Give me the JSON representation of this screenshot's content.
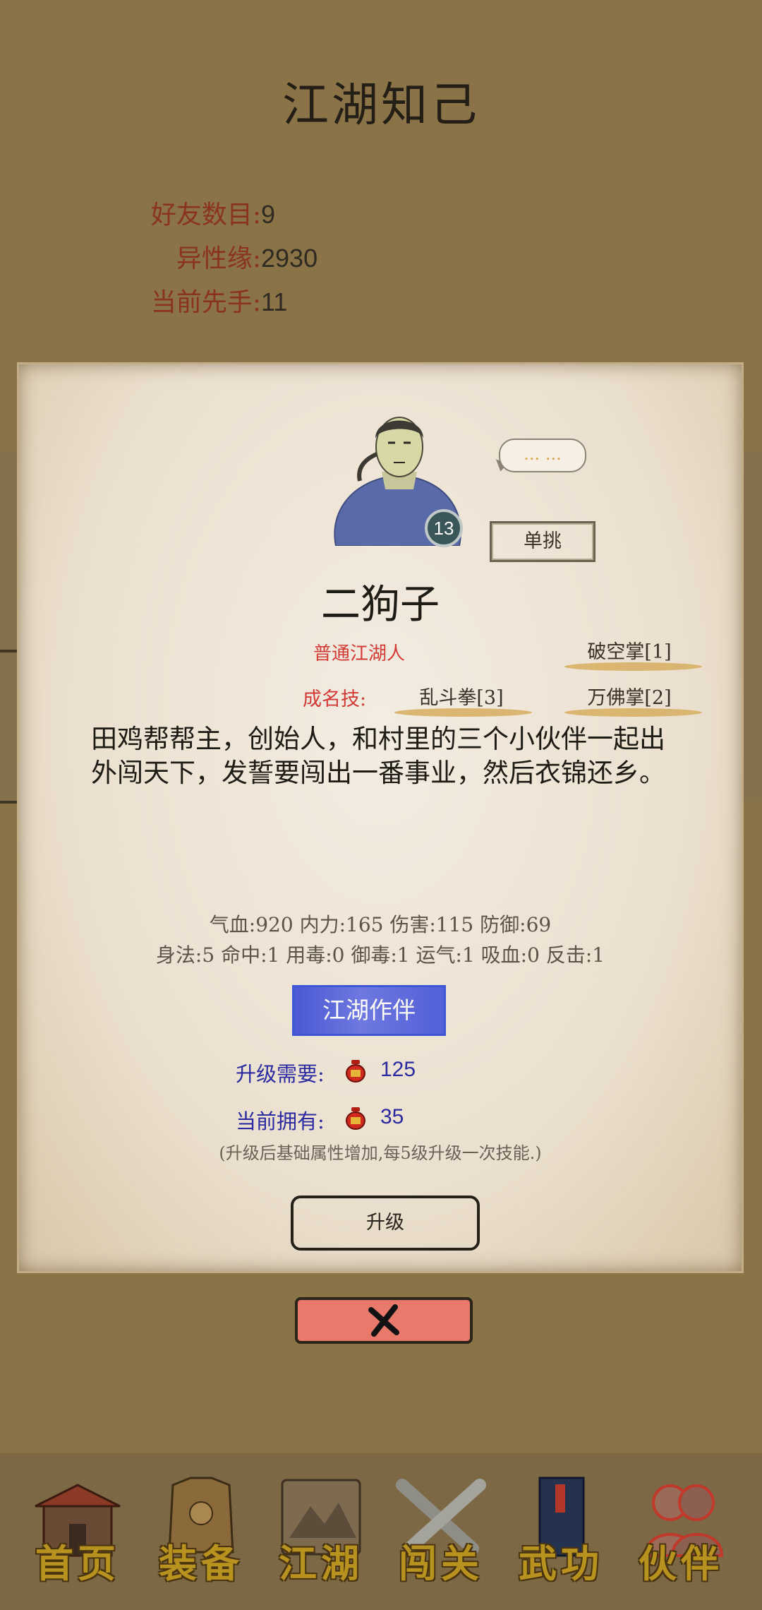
{
  "page": {
    "title": "江湖知己",
    "stats": [
      {
        "label": "好友数目:",
        "value": "9"
      },
      {
        "label": "异性缘:",
        "value": "2930"
      },
      {
        "label": "当前先手:",
        "value": "11"
      }
    ]
  },
  "dialog": {
    "level": "13",
    "speech": "... ...",
    "duel_label": "单挑",
    "name": "二狗子",
    "rank": "普通江湖人",
    "signature_label": "成名技:",
    "skills": [
      "破空掌[1]",
      "乱斗拳[3]",
      "万佛掌[2]"
    ],
    "description": "田鸡帮帮主，创始人，和村里的三个小伙伴一起出外闯天下，发誓要闯出一番事业，然后衣锦还乡。",
    "attributes_line1": "气血:920  内力:165  伤害:115  防御:69",
    "attributes_line2": "身法:5  命中:1  用毒:0  御毒:1  运气:1  吸血:0  反击:1",
    "companion_label": "江湖作伴",
    "upgrade_need_label": "升级需要:",
    "upgrade_need_value": "125",
    "current_have_label": "当前拥有:",
    "current_have_value": "35",
    "upgrade_note": "(升级后基础属性增加,每5级升级一次技能.)",
    "upgrade_label": "升级",
    "close_icon": "close-x-icon"
  },
  "nav": {
    "items": [
      {
        "label": "首页",
        "icon": "house-icon"
      },
      {
        "label": "装备",
        "icon": "armor-icon"
      },
      {
        "label": "江湖",
        "icon": "scroll-map-icon"
      },
      {
        "label": "闯关",
        "icon": "crossed-swords-icon"
      },
      {
        "label": "武功",
        "icon": "book-icon"
      },
      {
        "label": "伙伴",
        "icon": "partners-icon"
      }
    ]
  },
  "colors": {
    "accent_red": "#d43a35",
    "accent_blue": "#4b59d3",
    "nav_gold": "#b8921f",
    "close_button": "#e9796b"
  }
}
